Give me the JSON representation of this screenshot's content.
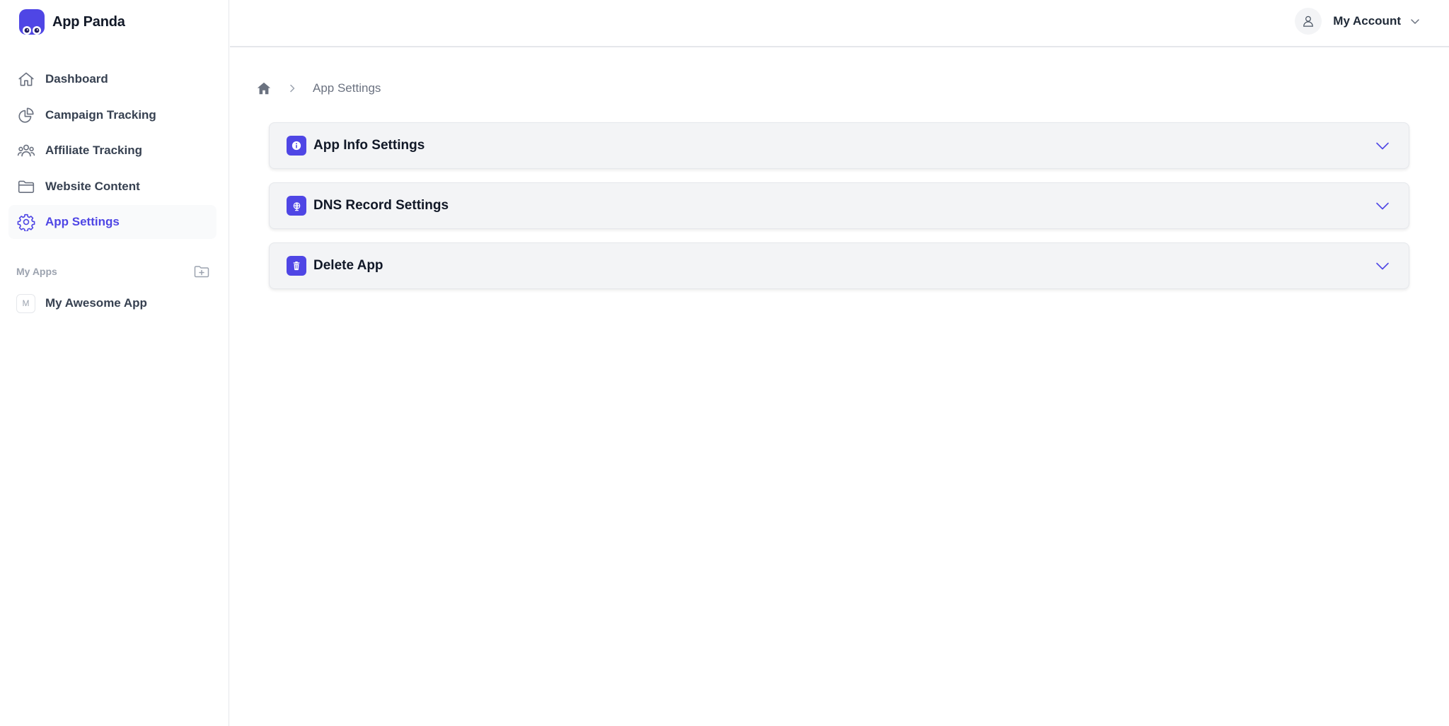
{
  "brand": {
    "name": "App Panda",
    "icon": "panda-logo",
    "accent": "#4f46e5"
  },
  "sidebar": {
    "items": [
      {
        "label": "Dashboard",
        "icon": "home-icon",
        "active": false
      },
      {
        "label": "Campaign Tracking",
        "icon": "pie-chart-icon",
        "active": false
      },
      {
        "label": "Affiliate Tracking",
        "icon": "users-icon",
        "active": false
      },
      {
        "label": "Website Content",
        "icon": "folder-icon",
        "active": false
      },
      {
        "label": "App Settings",
        "icon": "gear-icon",
        "active": true
      }
    ],
    "apps_section": {
      "title": "My Apps",
      "add_icon": "folder-plus-icon",
      "apps": [
        {
          "initial": "M",
          "label": "My Awesome App"
        }
      ]
    }
  },
  "topbar": {
    "account_label": "My Account",
    "avatar_icon": "user-icon",
    "chevron_icon": "chevron-down-icon"
  },
  "breadcrumb": {
    "home_icon": "home-icon",
    "separator_icon": "chevron-right-icon",
    "current": "App Settings"
  },
  "sections": [
    {
      "label": "App Info Settings",
      "icon": "info-icon"
    },
    {
      "label": "DNS Record Settings",
      "icon": "globe-icon"
    },
    {
      "label": "Delete App",
      "icon": "trash-icon"
    }
  ],
  "colors": {
    "accent": "#4f46e5",
    "active_bg": "#f9fafb",
    "card_bg": "#f3f4f6",
    "muted": "#9ca3af"
  }
}
